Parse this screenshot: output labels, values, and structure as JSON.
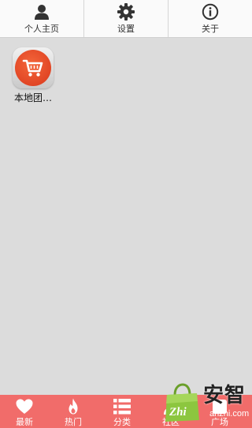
{
  "top_menu": {
    "items": [
      {
        "label": "个人主页",
        "icon": "person-icon"
      },
      {
        "label": "设置",
        "icon": "gear-icon"
      },
      {
        "label": "关于",
        "icon": "info-icon"
      }
    ]
  },
  "apps": [
    {
      "label": "本地团…",
      "icon": "shopping-cart-icon"
    }
  ],
  "bottom_nav": {
    "items": [
      {
        "label": "最新",
        "icon": "heart-icon"
      },
      {
        "label": "热门",
        "icon": "flame-icon"
      },
      {
        "label": "分类",
        "icon": "list-icon"
      },
      {
        "label": "社区",
        "icon": "community-icon"
      },
      {
        "label": "广场",
        "icon": "square-icon"
      }
    ]
  },
  "watermark": {
    "brand": "安智",
    "url": "anzhi.com",
    "logo_text": "Zhi"
  },
  "colors": {
    "background": "#dcdcdc",
    "top_bar": "#fafafa",
    "bottom_bar": "#f16c6a",
    "app_icon_red": "#e8492a",
    "watermark_green": "#8cc63f"
  }
}
